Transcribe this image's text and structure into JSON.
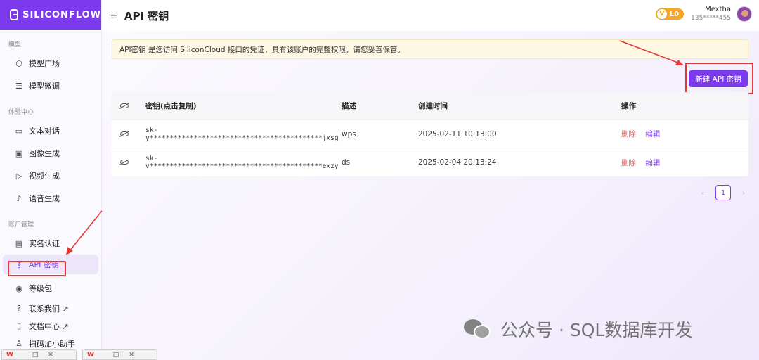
{
  "app": {
    "logo_text": "SILICONFLOW"
  },
  "sidebar": {
    "groups": [
      {
        "label": "模型",
        "items": [
          {
            "label": "模型广场",
            "icon": "cube-icon"
          },
          {
            "label": "模型微调",
            "icon": "sliders-icon"
          }
        ]
      },
      {
        "label": "体验中心",
        "items": [
          {
            "label": "文本对话",
            "icon": "chat-icon"
          },
          {
            "label": "图像生成",
            "icon": "image-icon"
          },
          {
            "label": "视频生成",
            "icon": "video-icon"
          },
          {
            "label": "语音生成",
            "icon": "audio-icon"
          }
        ]
      },
      {
        "label": "账户管理",
        "items": [
          {
            "label": "实名认证",
            "icon": "id-card-icon"
          },
          {
            "label": "API 密钥",
            "icon": "key-icon",
            "active": true
          },
          {
            "label": "等级包",
            "icon": "level-icon"
          },
          {
            "label": "联系我们 ↗",
            "icon": "help-icon"
          },
          {
            "label": "文档中心 ↗",
            "icon": "doc-icon"
          },
          {
            "label": "扫码加小助手",
            "icon": "user-icon"
          }
        ]
      }
    ]
  },
  "header": {
    "title": "API 密钥",
    "level": "L0",
    "level_mark": "V",
    "user_name": "Mextha",
    "user_phone": "135*****455"
  },
  "notice": "API密钥 是您访问 SiliconCloud 接口的凭证，具有该账户的完整权限，请您妥善保管。",
  "new_key_button": "新建 API 密钥",
  "table": {
    "headers": [
      "密钥(点击复制)",
      "描述",
      "创建时间",
      "操作"
    ],
    "rows": [
      {
        "key": "sk-y*******************************************jxsg",
        "desc": "wps",
        "created": "2025-02-11 10:13:00",
        "delete": "删除",
        "edit": "编辑"
      },
      {
        "key": "sk-v*******************************************exzy",
        "desc": "ds",
        "created": "2025-02-04 20:13:24",
        "delete": "删除",
        "edit": "编辑"
      }
    ]
  },
  "pagination": {
    "current": "1",
    "prev": "‹",
    "next": "›"
  },
  "watermark": "公众号 · SQL数据库开发",
  "taskbar": {
    "app_label": "W",
    "min": "□",
    "close": "✕"
  },
  "colors": {
    "accent": "#7c3aed",
    "danger": "#e5534b",
    "annotation": "#e53935"
  }
}
